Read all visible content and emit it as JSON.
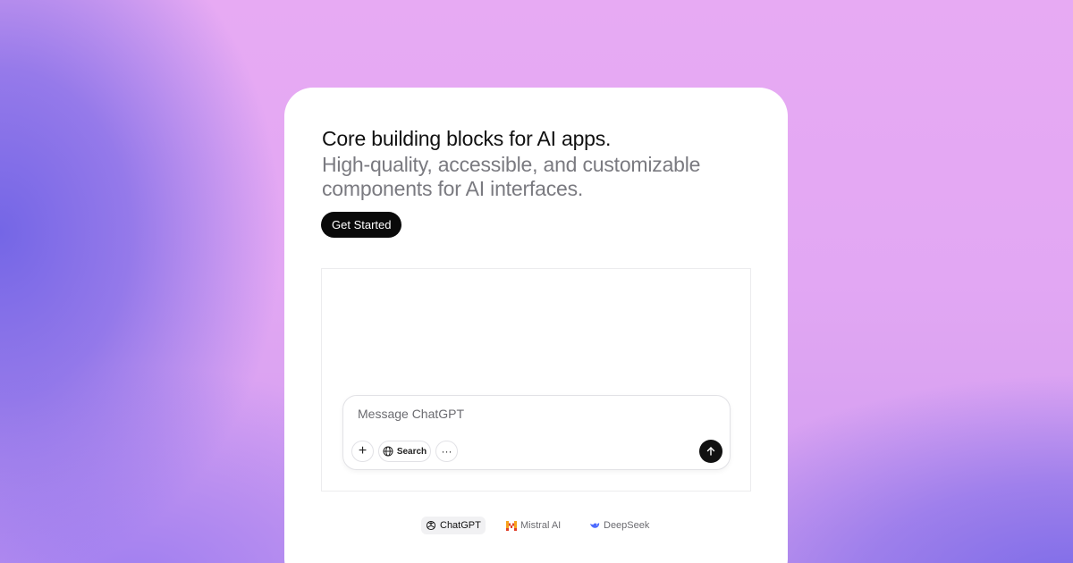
{
  "hero": {
    "title": "Core building blocks for AI apps.",
    "subtitle": "High-quality, accessible, and customizable components for AI interfaces.",
    "cta_label": "Get Started"
  },
  "composer": {
    "placeholder": "Message ChatGPT",
    "plus_label": "+",
    "search_label": "Search",
    "more_label": "···"
  },
  "models": [
    {
      "name": "ChatGPT",
      "icon": "openai-icon",
      "active": true
    },
    {
      "name": "Mistral AI",
      "icon": "mistral-icon",
      "active": false
    },
    {
      "name": "DeepSeek",
      "icon": "deepseek-icon",
      "active": false
    }
  ],
  "colors": {
    "button_bg": "#0a0a0a",
    "mistral_orange": "#f7a21b",
    "mistral_red": "#e0402a",
    "deepseek_blue": "#4d6bfe"
  }
}
